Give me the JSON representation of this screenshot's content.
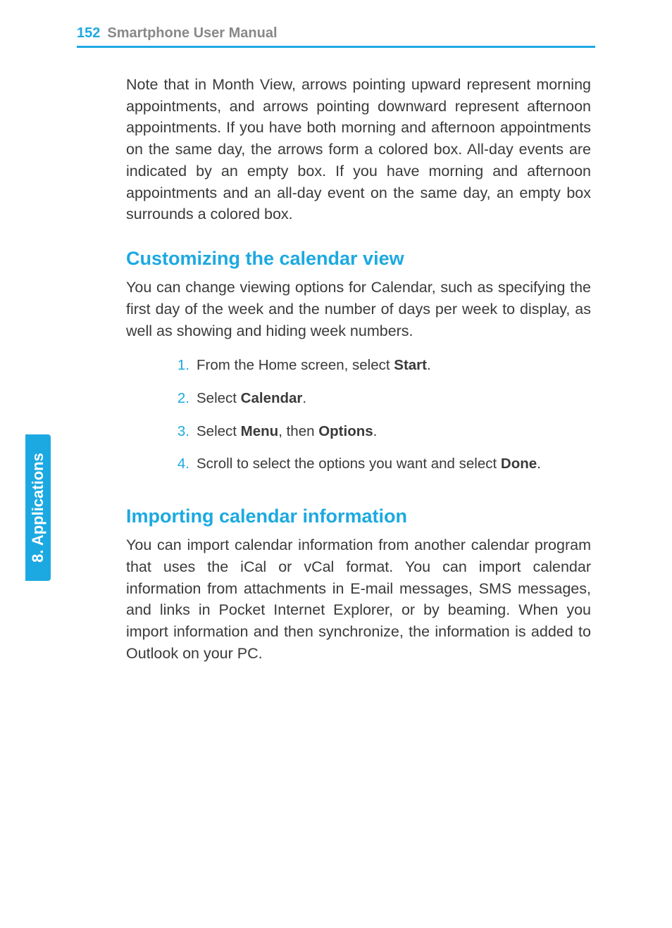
{
  "header": {
    "page_number": "152",
    "title": "Smartphone User Manual"
  },
  "side_tab": {
    "chapter": "8. ",
    "label": "Applications"
  },
  "body": {
    "intro_para": "Note that in Month View, arrows pointing upward represent morning appointments, and arrows pointing downward represent afternoon appointments.  If you have both morning and afternoon appointments on the same day, the arrows form a colored box.  All-day events are indicated by an empty box.  If you have morning and afternoon appointments and an all-day event on the same day, an empty box surrounds a colored box.",
    "section1": {
      "heading": "Customizing the calendar view",
      "para": "You can change viewing options for Calendar, such as specifying the first day of the week and the number of days per week to display, as well as showing and hiding week numbers.",
      "steps": [
        {
          "num": "1.",
          "pre": "From the Home screen, select ",
          "bold": "Start",
          "post": "."
        },
        {
          "num": "2.",
          "pre": "Select ",
          "bold": "Calendar",
          "post": "."
        },
        {
          "num": "3.",
          "pre": "Select ",
          "bold": "Menu",
          "mid": ", then ",
          "bold2": "Options",
          "post": "."
        },
        {
          "num": "4.",
          "pre": "Scroll to select the options you want and select ",
          "bold": "Done",
          "post": "."
        }
      ]
    },
    "section2": {
      "heading": "Importing calendar information",
      "para": "You can import calendar information from another calendar program that uses the iCal or vCal format.  You can import calendar information from attachments in E-mail messages, SMS messages, and links in Pocket Internet Explorer, or by beaming.  When you import information and then synchronize, the information is added to Outlook on your PC."
    }
  }
}
